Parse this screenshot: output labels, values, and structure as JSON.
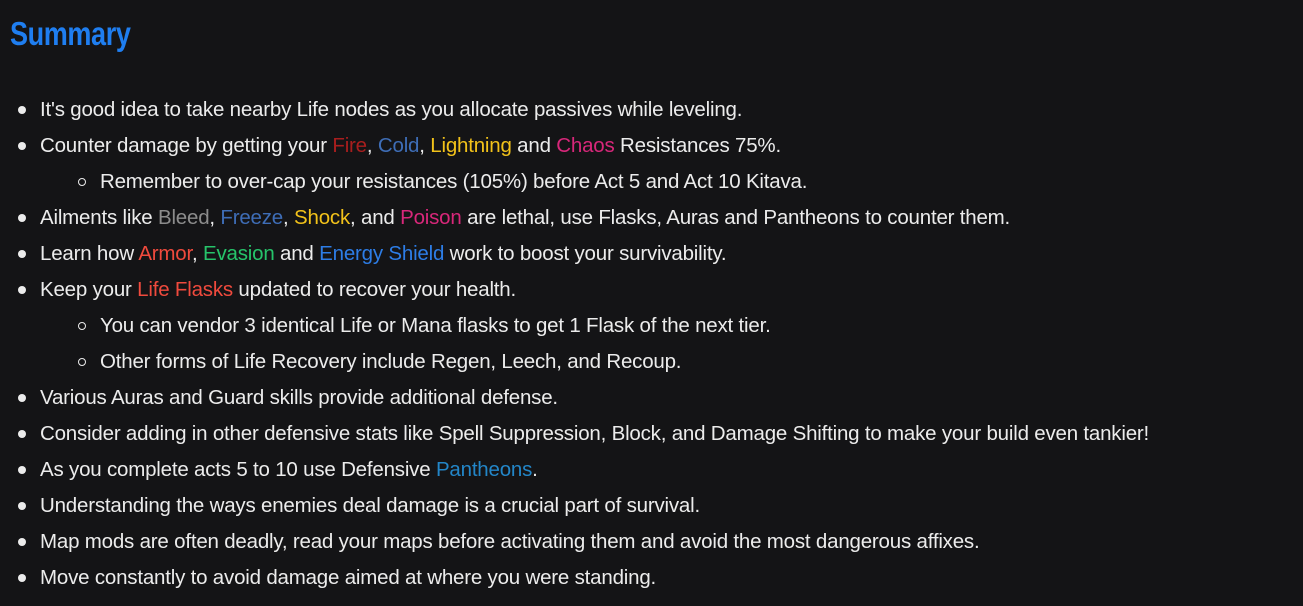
{
  "title": "Summary",
  "title_color": "#1f7ef0",
  "text_color": "#ececec",
  "background": "#141416",
  "items": [
    {
      "level": 1,
      "segments": [
        {
          "text": "It's good idea to take nearby Life nodes as you allocate passives while leveling."
        }
      ]
    },
    {
      "level": 1,
      "segments": [
        {
          "text": "Counter damage by getting your "
        },
        {
          "text": "Fire",
          "color": "#a81e1e"
        },
        {
          "text": ", "
        },
        {
          "text": "Cold",
          "color": "#3e6db6"
        },
        {
          "text": ", "
        },
        {
          "text": "Lightning",
          "color": "#f2c21a"
        },
        {
          "text": " and "
        },
        {
          "text": "Chaos",
          "color": "#d8277a"
        },
        {
          "text": " Resistances 75%."
        }
      ]
    },
    {
      "level": 2,
      "segments": [
        {
          "text": "Remember to over-cap your resistances (105%) before Act 5 and Act 10 Kitava."
        }
      ]
    },
    {
      "level": 1,
      "segments": [
        {
          "text": "Ailments like "
        },
        {
          "text": "Bleed",
          "color": "#8c8c8c"
        },
        {
          "text": ", "
        },
        {
          "text": "Freeze",
          "color": "#3e6db6"
        },
        {
          "text": ", "
        },
        {
          "text": "Shock",
          "color": "#f2c21a"
        },
        {
          "text": ", and "
        },
        {
          "text": "Poison",
          "color": "#d8277a"
        },
        {
          "text": " are lethal, use Flasks, Auras and Pantheons to counter them."
        }
      ]
    },
    {
      "level": 1,
      "segments": [
        {
          "text": "Learn how "
        },
        {
          "text": "Armor",
          "color": "#f04a3d"
        },
        {
          "text": ", "
        },
        {
          "text": "Evasion",
          "color": "#26c46a"
        },
        {
          "text": " and "
        },
        {
          "text": "Energy Shield",
          "color": "#2d7de6"
        },
        {
          "text": " work to boost your survivability."
        }
      ]
    },
    {
      "level": 1,
      "segments": [
        {
          "text": "Keep your "
        },
        {
          "text": "Life Flasks",
          "color": "#f04a3d"
        },
        {
          "text": " updated to recover your health."
        }
      ]
    },
    {
      "level": 2,
      "segments": [
        {
          "text": "You can vendor 3 identical Life or Mana flasks to get 1 Flask of the next tier."
        }
      ]
    },
    {
      "level": 2,
      "segments": [
        {
          "text": "Other forms of Life Recovery include Regen, Leech, and Recoup."
        }
      ]
    },
    {
      "level": 1,
      "segments": [
        {
          "text": "Various Auras and Guard skills provide additional defense."
        }
      ]
    },
    {
      "level": 1,
      "segments": [
        {
          "text": "Consider adding in other defensive stats like Spell Suppression, Block, and Damage Shifting to make your build even tankier!"
        }
      ]
    },
    {
      "level": 1,
      "segments": [
        {
          "text": "As you complete acts 5 to 10 use Defensive "
        },
        {
          "text": "Pantheons",
          "color": "#2386c8"
        },
        {
          "text": "."
        }
      ]
    },
    {
      "level": 1,
      "segments": [
        {
          "text": "Understanding the ways enemies deal damage is a crucial part of survival."
        }
      ]
    },
    {
      "level": 1,
      "segments": [
        {
          "text": "Map mods are often deadly, read your maps before activating them and avoid the most dangerous affixes."
        }
      ]
    },
    {
      "level": 1,
      "segments": [
        {
          "text": "Move constantly to avoid damage aimed at where you were standing."
        }
      ]
    }
  ]
}
